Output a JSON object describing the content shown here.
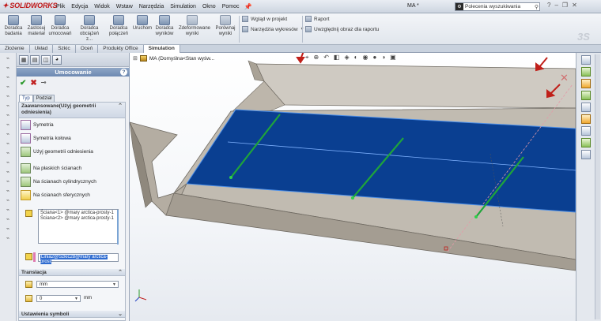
{
  "app": {
    "logo_text": "SOLIDWORKS",
    "doc_title": "MA *"
  },
  "menu": {
    "items": [
      "Plik",
      "Edycja",
      "Widok",
      "Wstaw",
      "Narzędzia",
      "Simulation",
      "Okno",
      "Pomoc"
    ]
  },
  "search": {
    "text": "Polecenia wyszukiwania"
  },
  "ribbon": {
    "buttons": [
      {
        "label": "Doradca badania"
      },
      {
        "label": "Zastosuj materiał"
      },
      {
        "label": "Doradca umocowań"
      },
      {
        "label": "Doradca obciążeń z..."
      },
      {
        "label": "Doradca połączeń"
      },
      {
        "label": "Uruchom"
      },
      {
        "label": "Doradca wyników"
      },
      {
        "label": "Zdeformowane wyniki"
      },
      {
        "label": "Porównaj wyniki"
      }
    ],
    "lines": {
      "view_in_project": "Wgląd w projekt",
      "chart_tools": "Narzędzia wykresów",
      "report": "Raport",
      "include_image": "Uwzględnij obraz dla raportu"
    }
  },
  "tabs": [
    "Złożenie",
    "Układ",
    "Szkic",
    "Oceń",
    "Produkty Office",
    "Simulation"
  ],
  "active_tab": "Simulation",
  "property_manager": {
    "title": "Umocowanie",
    "subtabs": [
      "Typ",
      "Podział"
    ],
    "group_title": "Zaawansowane(Użyj geometrii odniesienia)",
    "options": [
      "Symetria",
      "Symetria kołowa",
      "Użyj geometrii odniesienia"
    ],
    "radios": [
      "Na płaskich ścianach",
      "Na ścianach cylindrycznych",
      "Na ścianach sferycznych"
    ],
    "selections": [
      "Ściana<1> @mary arctica-prosty-1",
      "Ściana<2> @mary arctica-prosty-1"
    ],
    "reference": "Linia2@Szkic28@mary arctica-prost",
    "translation": {
      "title": "Translacja",
      "unit_select": "mm",
      "value": "0",
      "unit": "mm"
    },
    "symbol_settings": "Ustawienia symboli"
  },
  "viewport": {
    "tree_label": "MA  (Domyślna<Stan wyśw...",
    "colors": {
      "face_blue": "#0a3f91",
      "steel": "#b8b1a6",
      "arrow_green": "#1fa53a",
      "arrow_red": "#c0201a"
    }
  }
}
